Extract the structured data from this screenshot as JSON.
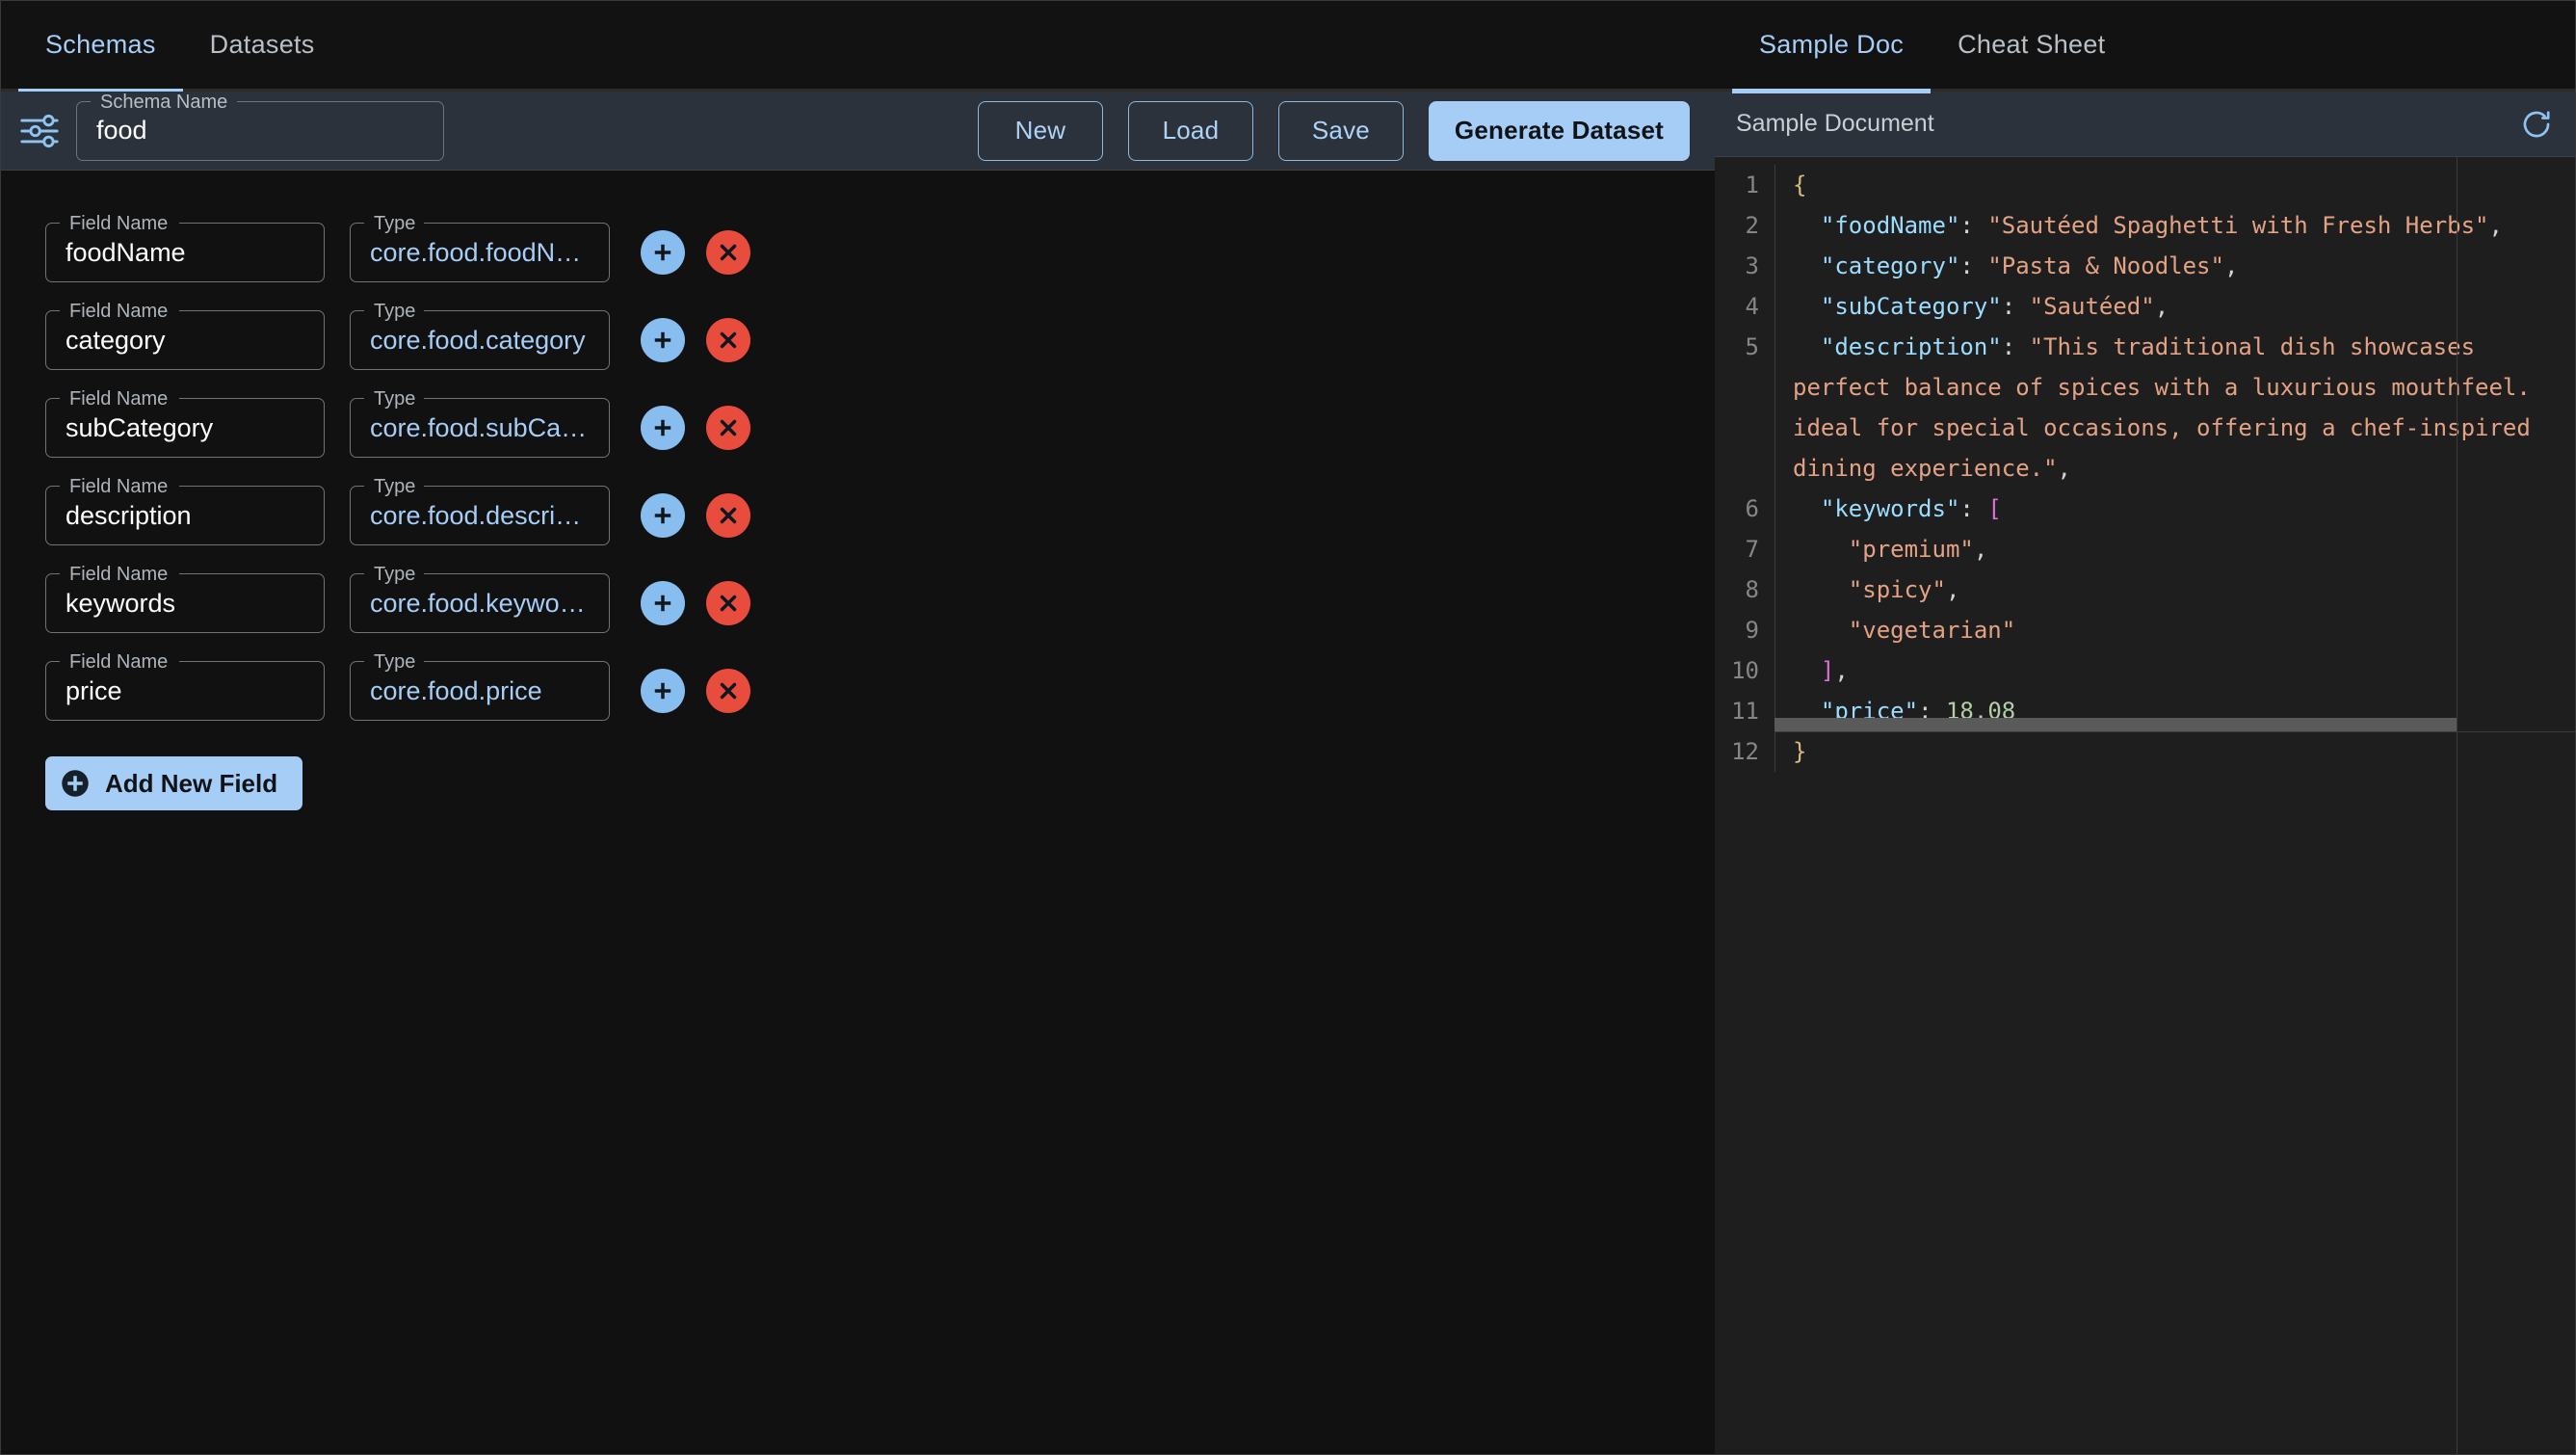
{
  "left": {
    "tabs": [
      {
        "label": "Schemas",
        "active": true
      },
      {
        "label": "Datasets",
        "active": false
      }
    ],
    "toolbar": {
      "tune_icon": "sliders-icon",
      "schema_name_label": "Schema Name",
      "schema_name_value": "food",
      "buttons": [
        {
          "label": "New",
          "primary": false
        },
        {
          "label": "Load",
          "primary": false
        },
        {
          "label": "Save",
          "primary": false
        },
        {
          "label": "Generate Dataset",
          "primary": true
        }
      ]
    },
    "fields": {
      "name_label": "Field Name",
      "type_label": "Type",
      "add_icon": "plus-circle-icon",
      "delete_icon": "close-circle-icon",
      "rows": [
        {
          "name": "foodName",
          "type": "core.food.foodName"
        },
        {
          "name": "category",
          "type": "core.food.category"
        },
        {
          "name": "subCategory",
          "type": "core.food.subCategory"
        },
        {
          "name": "description",
          "type": "core.food.description"
        },
        {
          "name": "keywords",
          "type": "core.food.keywords"
        },
        {
          "name": "price",
          "type": "core.food.price"
        }
      ],
      "add_new_field_label": "Add New Field"
    }
  },
  "right": {
    "tabs": [
      {
        "label": "Sample Doc",
        "active": true
      },
      {
        "label": "Cheat Sheet",
        "active": false
      }
    ],
    "doc_header": {
      "title": "Sample Document",
      "refresh_icon": "refresh-icon"
    },
    "document": {
      "line_numbers": [
        "1",
        "2",
        "3",
        "4",
        "5",
        "6",
        "7",
        "8",
        "9",
        "10",
        "11",
        "12"
      ],
      "json": {
        "foodName": "Sautéed Spaghetti with Fresh Herbs",
        "category": "Pasta & Noodles",
        "subCategory": "Sautéed",
        "description": "This traditional dish showcases perfect balance of spices with a luxurious mouthfeel. ideal for special occasions, offering a chef-inspired dining experience.",
        "keywords": [
          "premium",
          "spicy",
          "vegetarian"
        ],
        "price": "18.08"
      }
    }
  },
  "colors": {
    "accent": "#a5cdf5",
    "danger": "#e84c3d",
    "add": "#88bdf0",
    "toolbar_bg": "#2b323b",
    "panel_bg": "#111111",
    "editor_bg": "#1e1e1e",
    "json_key": "#9cdcfe",
    "json_string": "#e3a284",
    "json_number": "#b5cea8",
    "json_brace": "#d7ba7d",
    "json_bracket": "#da70d6"
  }
}
